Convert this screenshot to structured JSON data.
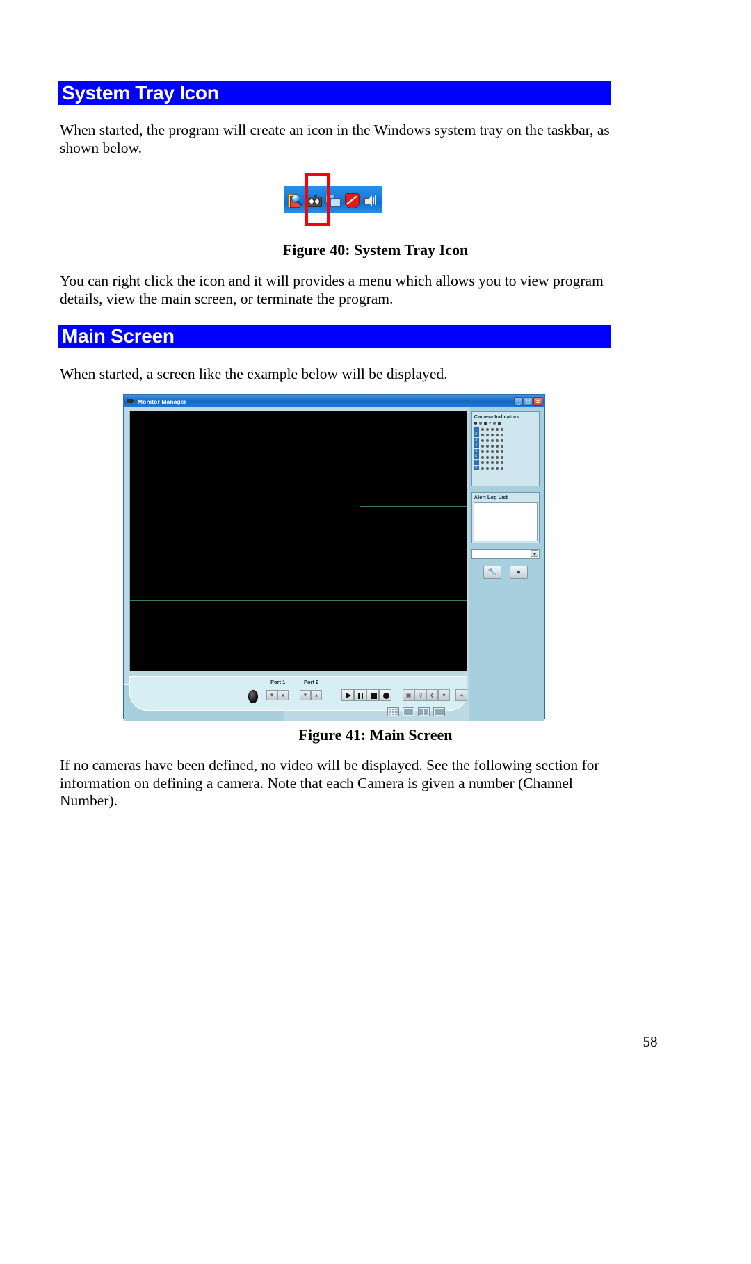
{
  "document": {
    "page_number": "58"
  },
  "sections": [
    {
      "heading": "System Tray Icon",
      "paragraphs": [
        "When started, the program will create an icon in the Windows system tray on the taskbar, as shown below.",
        "You can right click the icon and it will provides a menu which allows you to view program details, view the main screen, or terminate the program."
      ]
    },
    {
      "heading": "Main Screen",
      "paragraphs": [
        "When started, a screen like the example below will be displayed.",
        "If no cameras have been defined, no video will be displayed. See the following section for information on defining a camera. Note that each Camera is given a number (Channel Number)."
      ]
    }
  ],
  "figures": [
    {
      "caption": "Figure 40: System Tray Icon",
      "tray": {
        "icons": [
          "scanner-icon",
          "camera-icon",
          "network-icon",
          "antivirus-shield-icon",
          "speaker-icon"
        ],
        "highlighted_icon": "camera-icon",
        "highlight_color": "#ff0000",
        "bar_color": "#1a7fdc"
      }
    },
    {
      "caption": "Figure 41: Main Screen",
      "window": {
        "title": "Monitor Manager",
        "title_icon": "camera-icon",
        "title_buttons": [
          "_",
          "□",
          "✕"
        ],
        "panels": {
          "camera_indicators": {
            "title": "Camera Indicators",
            "channels": [
              "1",
              "2",
              "3",
              "4",
              "5",
              "6",
              "7",
              "8"
            ],
            "columns": 5
          },
          "alert_log": {
            "title": "Alert Log List",
            "entries": []
          },
          "combo_value": "",
          "tool_buttons": [
            "settings-wrench-icon",
            "camera-setup-icon"
          ]
        },
        "controls": {
          "port1_label": "Port 1",
          "port2_label": "Port 2",
          "transport_buttons": [
            "play-icon",
            "pause-icon",
            "stop-icon",
            "record-icon"
          ],
          "camera_buttons": [
            "snapshot-icon",
            "zoom-icon",
            "pan-left-icon",
            "tilt-down-icon"
          ],
          "extra_button": "focus-icon",
          "layout_buttons": [
            "layout-9-icon",
            "layout-6-icon",
            "layout-4-icon",
            "layout-1-icon"
          ]
        }
      }
    }
  ],
  "colors": {
    "heading_bar": "#0000ff",
    "heading_text": "#ffffff",
    "window_chrome": "#a8cfdd",
    "video_background": "#000000",
    "grid_line": "#3e7f52"
  }
}
